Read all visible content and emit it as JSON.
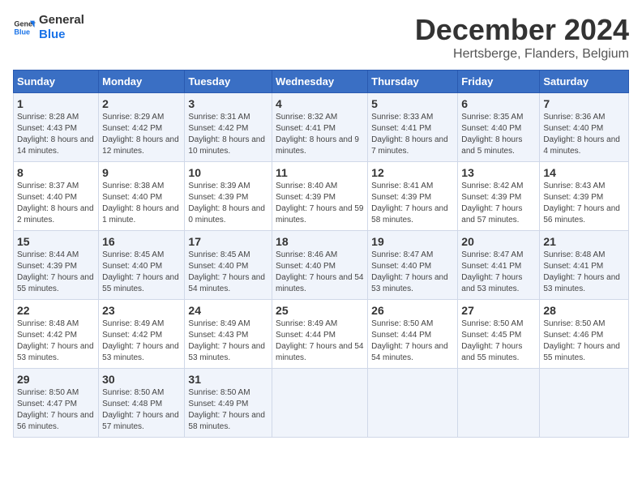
{
  "logo": {
    "line1": "General",
    "line2": "Blue"
  },
  "title": "December 2024",
  "subtitle": "Hertsberge, Flanders, Belgium",
  "days_of_week": [
    "Sunday",
    "Monday",
    "Tuesday",
    "Wednesday",
    "Thursday",
    "Friday",
    "Saturday"
  ],
  "weeks": [
    [
      {
        "day": "1",
        "sunrise": "Sunrise: 8:28 AM",
        "sunset": "Sunset: 4:43 PM",
        "daylight": "Daylight: 8 hours and 14 minutes."
      },
      {
        "day": "2",
        "sunrise": "Sunrise: 8:29 AM",
        "sunset": "Sunset: 4:42 PM",
        "daylight": "Daylight: 8 hours and 12 minutes."
      },
      {
        "day": "3",
        "sunrise": "Sunrise: 8:31 AM",
        "sunset": "Sunset: 4:42 PM",
        "daylight": "Daylight: 8 hours and 10 minutes."
      },
      {
        "day": "4",
        "sunrise": "Sunrise: 8:32 AM",
        "sunset": "Sunset: 4:41 PM",
        "daylight": "Daylight: 8 hours and 9 minutes."
      },
      {
        "day": "5",
        "sunrise": "Sunrise: 8:33 AM",
        "sunset": "Sunset: 4:41 PM",
        "daylight": "Daylight: 8 hours and 7 minutes."
      },
      {
        "day": "6",
        "sunrise": "Sunrise: 8:35 AM",
        "sunset": "Sunset: 4:40 PM",
        "daylight": "Daylight: 8 hours and 5 minutes."
      },
      {
        "day": "7",
        "sunrise": "Sunrise: 8:36 AM",
        "sunset": "Sunset: 4:40 PM",
        "daylight": "Daylight: 8 hours and 4 minutes."
      }
    ],
    [
      {
        "day": "8",
        "sunrise": "Sunrise: 8:37 AM",
        "sunset": "Sunset: 4:40 PM",
        "daylight": "Daylight: 8 hours and 2 minutes."
      },
      {
        "day": "9",
        "sunrise": "Sunrise: 8:38 AM",
        "sunset": "Sunset: 4:40 PM",
        "daylight": "Daylight: 8 hours and 1 minute."
      },
      {
        "day": "10",
        "sunrise": "Sunrise: 8:39 AM",
        "sunset": "Sunset: 4:39 PM",
        "daylight": "Daylight: 8 hours and 0 minutes."
      },
      {
        "day": "11",
        "sunrise": "Sunrise: 8:40 AM",
        "sunset": "Sunset: 4:39 PM",
        "daylight": "Daylight: 7 hours and 59 minutes."
      },
      {
        "day": "12",
        "sunrise": "Sunrise: 8:41 AM",
        "sunset": "Sunset: 4:39 PM",
        "daylight": "Daylight: 7 hours and 58 minutes."
      },
      {
        "day": "13",
        "sunrise": "Sunrise: 8:42 AM",
        "sunset": "Sunset: 4:39 PM",
        "daylight": "Daylight: 7 hours and 57 minutes."
      },
      {
        "day": "14",
        "sunrise": "Sunrise: 8:43 AM",
        "sunset": "Sunset: 4:39 PM",
        "daylight": "Daylight: 7 hours and 56 minutes."
      }
    ],
    [
      {
        "day": "15",
        "sunrise": "Sunrise: 8:44 AM",
        "sunset": "Sunset: 4:39 PM",
        "daylight": "Daylight: 7 hours and 55 minutes."
      },
      {
        "day": "16",
        "sunrise": "Sunrise: 8:45 AM",
        "sunset": "Sunset: 4:40 PM",
        "daylight": "Daylight: 7 hours and 55 minutes."
      },
      {
        "day": "17",
        "sunrise": "Sunrise: 8:45 AM",
        "sunset": "Sunset: 4:40 PM",
        "daylight": "Daylight: 7 hours and 54 minutes."
      },
      {
        "day": "18",
        "sunrise": "Sunrise: 8:46 AM",
        "sunset": "Sunset: 4:40 PM",
        "daylight": "Daylight: 7 hours and 54 minutes."
      },
      {
        "day": "19",
        "sunrise": "Sunrise: 8:47 AM",
        "sunset": "Sunset: 4:40 PM",
        "daylight": "Daylight: 7 hours and 53 minutes."
      },
      {
        "day": "20",
        "sunrise": "Sunrise: 8:47 AM",
        "sunset": "Sunset: 4:41 PM",
        "daylight": "Daylight: 7 hours and 53 minutes."
      },
      {
        "day": "21",
        "sunrise": "Sunrise: 8:48 AM",
        "sunset": "Sunset: 4:41 PM",
        "daylight": "Daylight: 7 hours and 53 minutes."
      }
    ],
    [
      {
        "day": "22",
        "sunrise": "Sunrise: 8:48 AM",
        "sunset": "Sunset: 4:42 PM",
        "daylight": "Daylight: 7 hours and 53 minutes."
      },
      {
        "day": "23",
        "sunrise": "Sunrise: 8:49 AM",
        "sunset": "Sunset: 4:42 PM",
        "daylight": "Daylight: 7 hours and 53 minutes."
      },
      {
        "day": "24",
        "sunrise": "Sunrise: 8:49 AM",
        "sunset": "Sunset: 4:43 PM",
        "daylight": "Daylight: 7 hours and 53 minutes."
      },
      {
        "day": "25",
        "sunrise": "Sunrise: 8:49 AM",
        "sunset": "Sunset: 4:44 PM",
        "daylight": "Daylight: 7 hours and 54 minutes."
      },
      {
        "day": "26",
        "sunrise": "Sunrise: 8:50 AM",
        "sunset": "Sunset: 4:44 PM",
        "daylight": "Daylight: 7 hours and 54 minutes."
      },
      {
        "day": "27",
        "sunrise": "Sunrise: 8:50 AM",
        "sunset": "Sunset: 4:45 PM",
        "daylight": "Daylight: 7 hours and 55 minutes."
      },
      {
        "day": "28",
        "sunrise": "Sunrise: 8:50 AM",
        "sunset": "Sunset: 4:46 PM",
        "daylight": "Daylight: 7 hours and 55 minutes."
      }
    ],
    [
      {
        "day": "29",
        "sunrise": "Sunrise: 8:50 AM",
        "sunset": "Sunset: 4:47 PM",
        "daylight": "Daylight: 7 hours and 56 minutes."
      },
      {
        "day": "30",
        "sunrise": "Sunrise: 8:50 AM",
        "sunset": "Sunset: 4:48 PM",
        "daylight": "Daylight: 7 hours and 57 minutes."
      },
      {
        "day": "31",
        "sunrise": "Sunrise: 8:50 AM",
        "sunset": "Sunset: 4:49 PM",
        "daylight": "Daylight: 7 hours and 58 minutes."
      },
      null,
      null,
      null,
      null
    ]
  ]
}
